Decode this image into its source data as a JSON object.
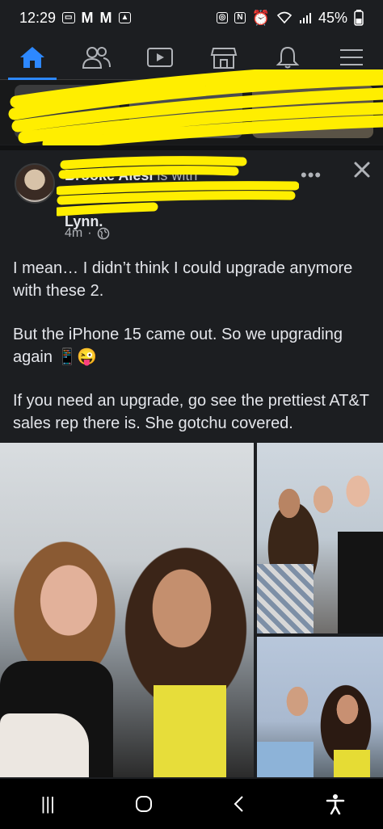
{
  "status_bar": {
    "time": "12:29",
    "notif_icons": [
      "cast-icon",
      "gmail-icon",
      "gmail-icon",
      "gallery-icon"
    ],
    "battery": "45%",
    "system_icons": [
      "nfc-icon",
      "n-icon",
      "alarm-icon",
      "wifi-icon",
      "signal-icon",
      "battery-icon"
    ]
  },
  "nav": {
    "items": [
      {
        "name": "home",
        "icon": "home-icon",
        "active": true
      },
      {
        "name": "friends",
        "icon": "friends-icon",
        "active": false
      },
      {
        "name": "watch",
        "icon": "video-icon",
        "active": false
      },
      {
        "name": "marketplace",
        "icon": "marketplace-icon",
        "active": false
      },
      {
        "name": "notifications",
        "icon": "bell-icon",
        "active": false
      },
      {
        "name": "menu",
        "icon": "hamburger-icon",
        "active": false
      }
    ],
    "accent": "#2d88ff"
  },
  "post": {
    "author_visible": "Brooke Alesi",
    "with_text": " is with",
    "tagged_visible": "Lynn.",
    "time": "4m",
    "audience_icon": "globe-icon",
    "paragraphs": [
      "I mean… I didn’t think I could upgrade anymore with these 2.",
      "But the iPhone 15 came out. So we upgrading again 📱😜",
      "If you need an upgrade, go see the prettiest AT&T sales rep there is. She gotchu covered."
    ]
  },
  "android_nav": {
    "recent": "|||",
    "home": "◯",
    "back": "‹",
    "accessibility": "accessibility-icon"
  },
  "colors": {
    "background": "#1c1e21",
    "text": "#e4e6eb",
    "muted": "#b0b3b8",
    "redaction": "#ffee00"
  }
}
